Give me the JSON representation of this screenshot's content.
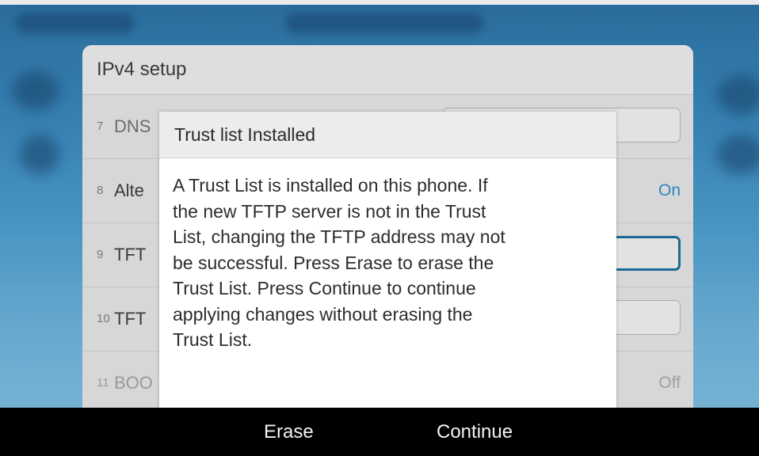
{
  "panel": {
    "title": "IPv4 setup",
    "rows": [
      {
        "num": "7",
        "label": "DNS"
      },
      {
        "num": "8",
        "label": "Alte",
        "value": "On"
      },
      {
        "num": "9",
        "label": "TFT"
      },
      {
        "num": "10",
        "label": "TFT"
      },
      {
        "num": "11",
        "label": "BOO",
        "value": "Off"
      }
    ]
  },
  "dialog": {
    "title": "Trust list Installed",
    "body": "A Trust List is installed on this phone.  If\nthe new TFTP server is not in the Trust\nList, changing the TFTP address may not\nbe successful.  Press Erase to erase the\nTrust List.  Press Continue to continue\napplying changes without erasing the\nTrust List."
  },
  "softkeys": {
    "erase": "Erase",
    "continue": "Continue"
  },
  "colors": {
    "accent": "#2c86bd",
    "focus_border": "#1d6a97",
    "softkey_bar": "#000000"
  }
}
